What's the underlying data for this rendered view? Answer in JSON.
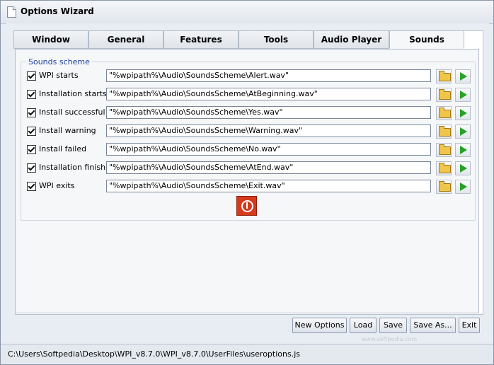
{
  "window": {
    "title": "Options Wizard"
  },
  "tabs": [
    {
      "label": "Window",
      "active": false
    },
    {
      "label": "General",
      "active": false
    },
    {
      "label": "Features",
      "active": false
    },
    {
      "label": "Tools",
      "active": false
    },
    {
      "label": "Audio Player",
      "active": false
    },
    {
      "label": "Sounds",
      "active": true
    }
  ],
  "sounds": {
    "group_label": "Sounds scheme",
    "rows": [
      {
        "label": "WPI starts",
        "checked": true,
        "path": "\"%wpipath%\\Audio\\SoundsScheme\\Alert.wav\""
      },
      {
        "label": "Installation starts",
        "checked": true,
        "path": "\"%wpipath%\\Audio\\SoundsScheme\\AtBeginning.wav\""
      },
      {
        "label": "Install successful",
        "checked": true,
        "path": "\"%wpipath%\\Audio\\SoundsScheme\\Yes.wav\""
      },
      {
        "label": "Install warning",
        "checked": true,
        "path": "\"%wpipath%\\Audio\\SoundsScheme\\Warning.wav\""
      },
      {
        "label": "Install failed",
        "checked": true,
        "path": "\"%wpipath%\\Audio\\SoundsScheme\\No.wav\""
      },
      {
        "label": "Installation finished",
        "checked": true,
        "path": "\"%wpipath%\\Audio\\SoundsScheme\\AtEnd.wav\""
      },
      {
        "label": "WPI exits",
        "checked": true,
        "path": "\"%wpipath%\\Audio\\SoundsScheme\\Exit.wav\""
      }
    ]
  },
  "buttons": {
    "new_options": "New Options",
    "load": "Load",
    "save": "Save",
    "save_as": "Save As...",
    "exit": "Exit"
  },
  "status": {
    "path": "C:\\Users\\Softpedia\\Desktop\\WPI_v8.7.0\\WPI_v8.7.0\\UserFiles\\useroptions.js"
  },
  "watermark": "www.softpedia.com",
  "icons": {
    "browse": "folder-icon",
    "play": "play-icon",
    "stop": "stop-icon"
  },
  "colors": {
    "group_label": "#1b3f9a",
    "play": "#27a227",
    "stop": "#d63a1d",
    "folder": "#f0c64a"
  }
}
